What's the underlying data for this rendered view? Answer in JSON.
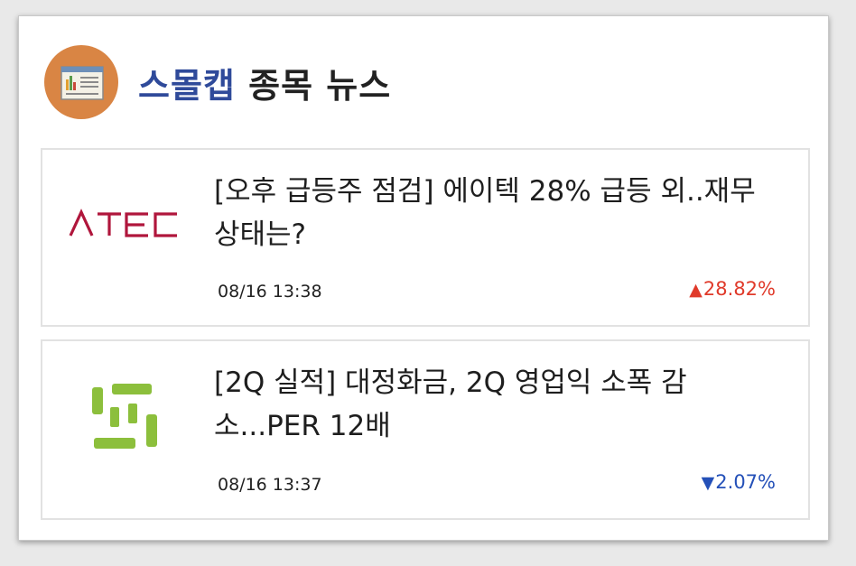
{
  "header": {
    "title_accent": "스몰캡",
    "title_rest": " 종목 뉴스",
    "icon": "newspaper-icon"
  },
  "news": [
    {
      "logo_text": "ATEC",
      "logo_color": "#b0163c",
      "headline": "[오후 급등주 점검] 에이텍 28% 급등 외..재무 상태는?",
      "timestamp": "08/16 13:38",
      "direction": "up",
      "arrow": "▲",
      "change": "28.82%",
      "change_color": "#e03a2a"
    },
    {
      "logo_text": "",
      "logo_color": "#8cbf3c",
      "headline": "[2Q 실적] 대정화금, 2Q 영업익 소폭 감소...PER 12배",
      "timestamp": "08/16 13:37",
      "direction": "down",
      "arrow": "▼",
      "change": "2.07%",
      "change_color": "#2450b8"
    }
  ]
}
